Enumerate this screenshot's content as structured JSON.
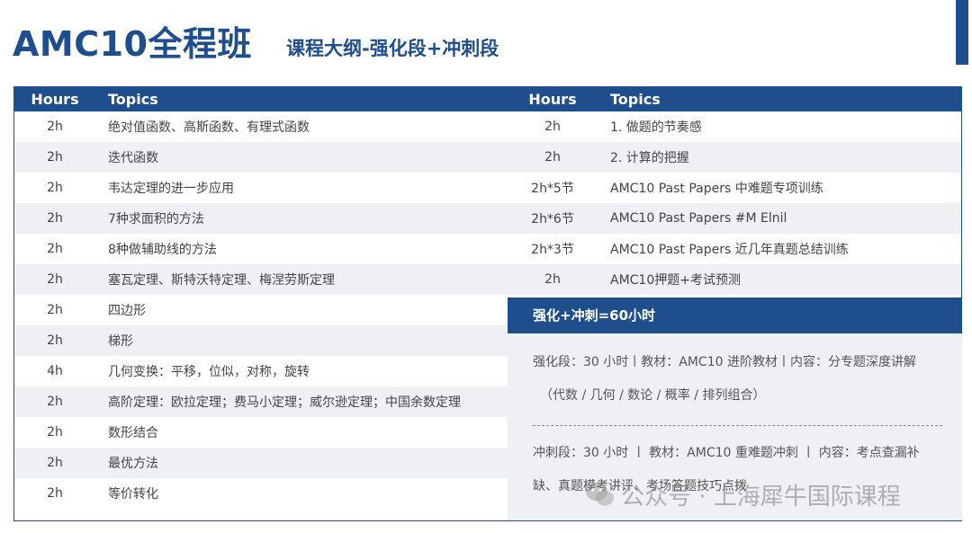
{
  "title": "AMC10全程班",
  "subtitle": "课程大纲-强化段+冲刺段",
  "headers": {
    "hours": "Hours",
    "topics": "Topics"
  },
  "left_rows": [
    {
      "hours": "2h",
      "topic": "绝对值函数、高斯函数、有理式函数"
    },
    {
      "hours": "2h",
      "topic": "迭代函数"
    },
    {
      "hours": "2h",
      "topic": "韦达定理的进一步应用"
    },
    {
      "hours": "2h",
      "topic": "7种求面积的方法"
    },
    {
      "hours": "2h",
      "topic": "8种做辅助线的方法"
    },
    {
      "hours": "2h",
      "topic": "塞瓦定理、斯特沃特定理、梅涅劳斯定理"
    },
    {
      "hours": "2h",
      "topic": "四边形"
    },
    {
      "hours": "2h",
      "topic": "梯形"
    },
    {
      "hours": "4h",
      "topic": "几何变换：平移，位似，对称，旋转"
    },
    {
      "hours": "2h",
      "topic": "高阶定理：欧拉定理；费马小定理；威尔逊定理；中国余数定理"
    },
    {
      "hours": "2h",
      "topic": "数形结合"
    },
    {
      "hours": "2h",
      "topic": "最优方法"
    },
    {
      "hours": "2h",
      "topic": "等价转化"
    }
  ],
  "right_rows": [
    {
      "hours": "2h",
      "topic": "1. 做题的节奏感"
    },
    {
      "hours": "2h",
      "topic": "2. 计算的把握"
    },
    {
      "hours": "2h*5节",
      "topic": "AMC10 Past Papers 中难题专项训练"
    },
    {
      "hours": "2h*6节",
      "topic": "AMC10 Past Papers #M Elnil"
    },
    {
      "hours": "2h*3节",
      "topic": "AMC10 Past Papers 近几年真题总结训练"
    },
    {
      "hours": "2h",
      "topic": "AMC10押题+考试预测"
    }
  ],
  "summary": {
    "header": "强化+冲刺=60小时",
    "strengthen_line1": "强化段：30 小时丨教材：AMC10 进阶教材丨内容：分专题深度讲解",
    "strengthen_line2": "（代数 / 几何 / 数论 / 概率 / 排列组合）",
    "sprint_line1": "冲刺段：30  小时  丨  教材：AMC10  重难题冲刺  丨  内容：考点查漏补",
    "sprint_line2": "缺、真题模考讲评、考场答题技巧点拨"
  },
  "watermark": "公众号 · 上海犀牛国际课程",
  "colors": {
    "primary": "#1f4e8c",
    "row_alt": "#eef0f3"
  }
}
